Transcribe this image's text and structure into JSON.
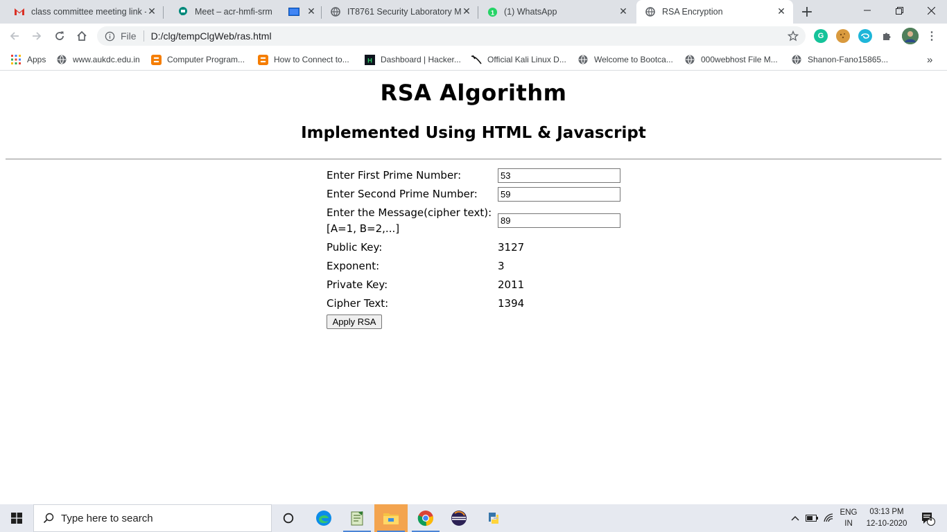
{
  "browser": {
    "tabs": [
      {
        "title": "class committee meeting link -",
        "icon": "gmail-icon"
      },
      {
        "title": "Meet – acr-hmfi-srm",
        "icon": "meet-icon"
      },
      {
        "title": "",
        "icon": "screen-share-icon"
      },
      {
        "title": "IT8761 Security Laboratory Ma",
        "icon": "globe-icon"
      },
      {
        "title": "(1) WhatsApp",
        "icon": "whatsapp-icon"
      },
      {
        "title": "RSA Encryption",
        "icon": "globe-icon"
      }
    ],
    "url_scheme_label": "File",
    "url": "D:/clg/tempClgWeb/ras.html",
    "bookmarks": [
      {
        "label": "Apps",
        "icon": "apps-grid-icon"
      },
      {
        "label": "www.aukdc.edu.in",
        "icon": "globe-icon"
      },
      {
        "label": "Computer Program...",
        "icon": "blogger-icon"
      },
      {
        "label": "How to Connect to...",
        "icon": "blogger-icon"
      },
      {
        "label": "Dashboard | Hacker...",
        "icon": "hackerrank-icon"
      },
      {
        "label": "Official Kali Linux D...",
        "icon": "kali-icon"
      },
      {
        "label": "Welcome to Bootca...",
        "icon": "globe-icon"
      },
      {
        "label": "000webhost File M...",
        "icon": "globe-icon"
      },
      {
        "label": "Shanon-Fano15865...",
        "icon": "globe-icon"
      }
    ],
    "bookmarks_overflow": "»"
  },
  "page": {
    "title": "RSA Algorithm",
    "subtitle": "Implemented Using HTML & Javascript",
    "form": {
      "first_prime_label": "Enter First Prime Number:",
      "first_prime_value": "53",
      "second_prime_label": "Enter Second Prime Number:",
      "second_prime_value": "59",
      "message_label_line1": "Enter the Message(cipher text):",
      "message_label_line2": "[A=1, B=2,...]",
      "message_value": "89",
      "public_key_label": "Public Key:",
      "public_key_value": "3127",
      "exponent_label": "Exponent:",
      "exponent_value": "3",
      "private_key_label": "Private Key:",
      "private_key_value": "2011",
      "cipher_text_label": "Cipher Text:",
      "cipher_text_value": "1394",
      "apply_button": "Apply RSA"
    }
  },
  "taskbar": {
    "search_placeholder": "Type here to search",
    "language_line1": "ENG",
    "language_line2": "IN",
    "time": "03:13 PM",
    "date": "12-10-2020",
    "notification_count": "4"
  },
  "colors": {
    "tabstrip": "#dee1e6",
    "taskbar": "#e6e9f0",
    "accent_blue": "#1a73e8"
  }
}
